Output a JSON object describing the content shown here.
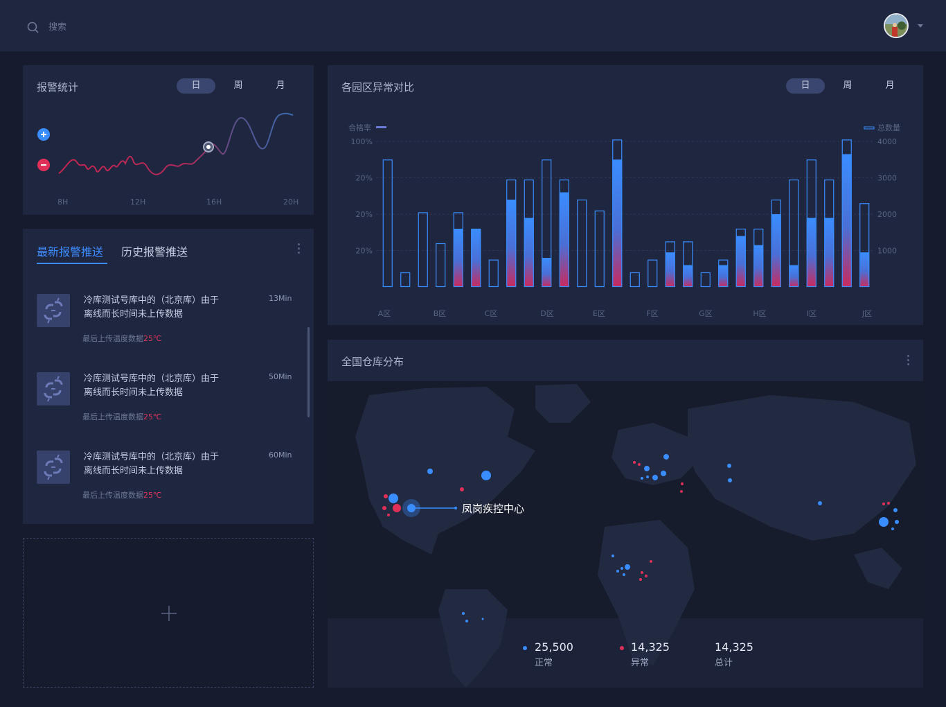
{
  "search": {
    "placeholder": "搜索"
  },
  "alarm_stats": {
    "title": "报警统计",
    "tabs": [
      "日",
      "周",
      "月"
    ],
    "active_tab": 0,
    "x_ticks": [
      "8H",
      "12H",
      "16H",
      "20H"
    ],
    "zoom_in_icon": "plus-icon",
    "zoom_out_icon": "minus-icon"
  },
  "alarm_list": {
    "tabs": [
      "最新报警推送",
      "历史报警推送"
    ],
    "active_tab": 0,
    "items": [
      {
        "line1": "冷库测试号库中的（北京库）由于",
        "line2": "离线而长时间未上传数据",
        "time": "13Min",
        "meta": "最后上传温度数据",
        "temp": "25℃"
      },
      {
        "line1": "冷库测试号库中的（北京库）由于",
        "line2": "离线而长时间未上传数据",
        "time": "50Min",
        "meta": "最后上传温度数据",
        "temp": "25℃"
      },
      {
        "line1": "冷库测试号库中的（北京库）由于",
        "line2": "离线而长时间未上传数据",
        "time": "60Min",
        "meta": "最后上传温度数据",
        "temp": "25℃"
      }
    ]
  },
  "park_compare": {
    "title": "各园区异常对比",
    "tabs": [
      "日",
      "周",
      "月"
    ],
    "active_tab": 0
  },
  "chart_data": {
    "type": "bar",
    "left_axis_label": "合格率",
    "right_axis_label": "总数量",
    "left_ticks": [
      "100%",
      "20%",
      "20%",
      "20%"
    ],
    "right_ticks": [
      "4000",
      "3000",
      "2000",
      "1000"
    ],
    "categories": [
      "A区",
      "B区",
      "C区",
      "D区",
      "E区",
      "F区",
      "G区",
      "H区",
      "I区",
      "J区"
    ],
    "ylim": [
      0,
      4000
    ],
    "series": [
      {
        "name": "总数量",
        "values": [
          3500,
          400,
          2050,
          1200,
          2050,
          1600,
          750,
          2950,
          2950,
          3500,
          2950,
          2400,
          2100,
          4050,
          400,
          750,
          1250,
          1250,
          400,
          750,
          1600,
          1600,
          2400,
          2950,
          3500,
          2950,
          4050,
          2300
        ]
      },
      {
        "name": "合格率",
        "values": [
          0,
          0,
          0,
          0,
          1600,
          1600,
          0,
          2400,
          1900,
          800,
          2600,
          0,
          0,
          3500,
          0,
          0,
          950,
          600,
          0,
          600,
          1400,
          1150,
          2000,
          600,
          1900,
          1900,
          3650,
          950
        ]
      }
    ]
  },
  "warehouse_map": {
    "title": "全国仓库分布",
    "highlight_label": "凤岗疾控中心",
    "stats": [
      {
        "value": "25,500",
        "label": "正常",
        "color": "#3a8dff"
      },
      {
        "value": "14,325",
        "label": "异常",
        "color": "#e0305a"
      },
      {
        "value": "14,325",
        "label": "总计",
        "color": ""
      }
    ]
  },
  "colors": {
    "accent": "#3d8bff",
    "alert": "#e0355c",
    "panel": "#1f2740",
    "background": "#161c2e"
  }
}
